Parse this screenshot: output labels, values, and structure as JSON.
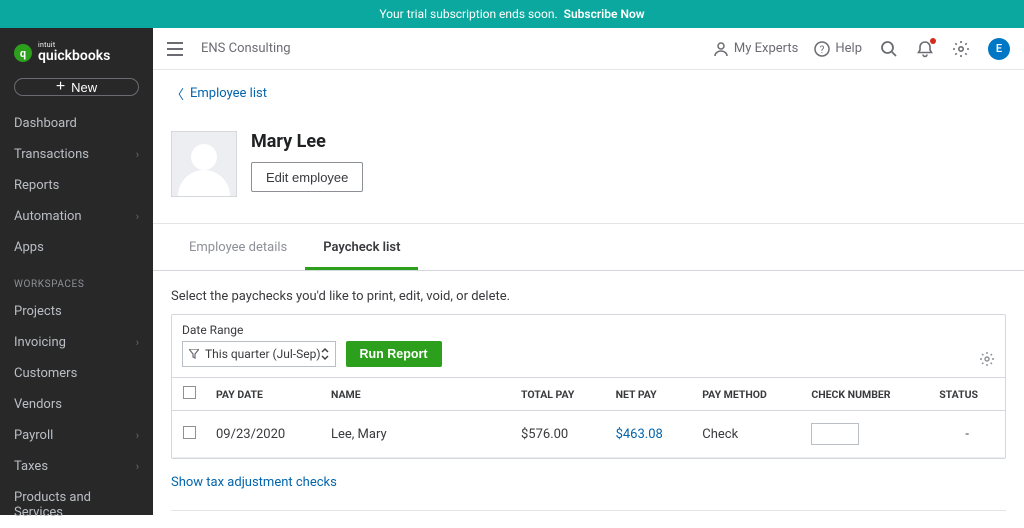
{
  "trial": {
    "text": "Your trial subscription ends soon.",
    "cta": "Subscribe Now"
  },
  "brand": {
    "sub": "intuit",
    "main": "quickbooks"
  },
  "new_label": "New",
  "nav": {
    "primary": [
      {
        "label": "Dashboard",
        "chev": false
      },
      {
        "label": "Transactions",
        "chev": true
      },
      {
        "label": "Reports",
        "chev": false
      },
      {
        "label": "Automation",
        "chev": true
      },
      {
        "label": "Apps",
        "chev": false
      }
    ],
    "section": "WORKSPACES",
    "workspaces": [
      {
        "label": "Projects",
        "chev": false
      },
      {
        "label": "Invoicing",
        "chev": true
      },
      {
        "label": "Customers",
        "chev": false
      },
      {
        "label": "Vendors",
        "chev": false
      },
      {
        "label": "Payroll",
        "chev": true
      },
      {
        "label": "Taxes",
        "chev": true
      },
      {
        "label": "Products and Services",
        "chev": false
      }
    ]
  },
  "top": {
    "company": "ENS Consulting",
    "experts": "My Experts",
    "help": "Help",
    "avatar": "E"
  },
  "back_link": "Employee list",
  "profile": {
    "name": "Mary Lee",
    "edit": "Edit employee"
  },
  "tabs": {
    "details": "Employee details",
    "paychecks": "Paycheck list"
  },
  "instruction": "Select the paychecks you'd like to print, edit, void, or delete.",
  "filter": {
    "label": "Date Range",
    "value": "This quarter (Jul-Sep)",
    "run": "Run Report"
  },
  "columns": {
    "paydate": "PAY DATE",
    "name": "NAME",
    "total": "TOTAL PAY",
    "net": "NET PAY",
    "method": "PAY METHOD",
    "check": "CHECK NUMBER",
    "status": "STATUS"
  },
  "rows": [
    {
      "paydate": "09/23/2020",
      "name": "Lee, Mary",
      "total": "$576.00",
      "net": "$463.08",
      "method": "Check",
      "status": "-"
    }
  ],
  "tax_link": "Show tax adjustment checks"
}
